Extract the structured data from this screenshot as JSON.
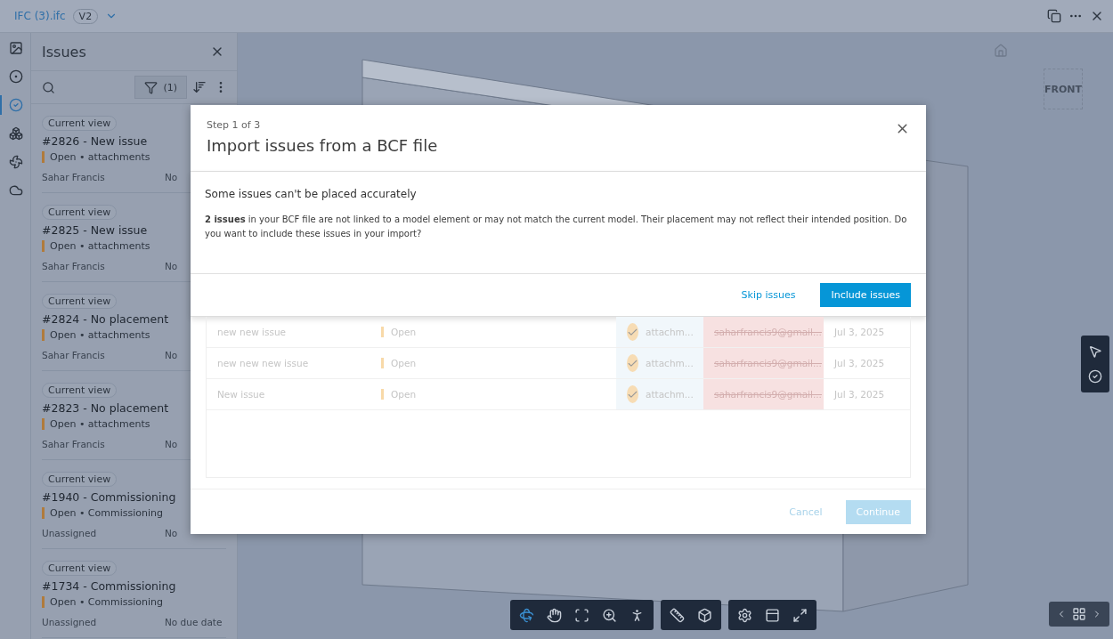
{
  "topbar": {
    "file": "IFC (3).ifc",
    "version": "V2"
  },
  "rail": [
    {
      "kind": "sheets",
      "selected": false
    },
    {
      "kind": "model",
      "selected": false
    },
    {
      "kind": "issues",
      "selected": true
    },
    {
      "kind": "search3d",
      "selected": false
    },
    {
      "kind": "systems",
      "selected": false
    },
    {
      "kind": "cloud",
      "selected": false
    }
  ],
  "issues_panel": {
    "title": "Issues",
    "filter_count": "(1)",
    "items": [
      {
        "tag": "Current view",
        "title": "#2826 - New issue",
        "meta": "Open • attachments",
        "assignee": "Sahar Francis",
        "due": "No"
      },
      {
        "tag": "Current view",
        "title": "#2825 - New issue",
        "meta": "Open • attachments",
        "assignee": "Sahar Francis",
        "due": "No"
      },
      {
        "tag": "Current view",
        "title": "#2824 - No placement",
        "meta": "Open • attachments",
        "assignee": "Sahar Francis",
        "due": "No"
      },
      {
        "tag": "Current view",
        "title": "#2823 - No placement",
        "meta": "Open • attachments",
        "assignee": "Sahar Francis",
        "due": "No"
      },
      {
        "tag": "Current view",
        "title": "#1940 - Commissioning",
        "meta": "Open • Commissioning",
        "assignee": "Unassigned",
        "due": "No"
      },
      {
        "tag": "Current view",
        "title": "#1734 - Commissioning",
        "meta": "Open • Commissioning",
        "assignee": "Unassigned",
        "due": "No due date"
      }
    ]
  },
  "viewcube": {
    "label": "FRONT"
  },
  "dialog": {
    "step": "Step 1 of 3",
    "title": "Import issues from a BCF file",
    "notice": {
      "heading": "Some issues can't be placed accurately",
      "text": "**2 issues** in your BCF file are not linked to a model element or may not match the current model. Their placement may not reflect their intended position. Do you want to include these issues in your import?",
      "buttons": [
        {
          "label": "Skip issues",
          "kind": "link",
          "disabled": false
        },
        {
          "label": "Include issues",
          "kind": "primary",
          "disabled": false
        }
      ]
    },
    "rows": [
      {
        "name": "new new issue",
        "status": "Open",
        "attachments": "attachm...",
        "author": "saharfrancis9@gmail...",
        "date": "Jul 3, 2025"
      },
      {
        "name": "new new new issue",
        "status": "Open",
        "attachments": "attachm...",
        "author": "saharfrancis9@gmail...",
        "date": "Jul 3, 2025"
      },
      {
        "name": "New issue",
        "status": "Open",
        "attachments": "attachm...",
        "author": "saharfrancis9@gmail...",
        "date": "Jul 3, 2025"
      }
    ],
    "footer": [
      {
        "label": "Cancel",
        "kind": "link",
        "disabled": true
      },
      {
        "label": "Continue",
        "kind": "primary",
        "disabled": true
      }
    ]
  }
}
